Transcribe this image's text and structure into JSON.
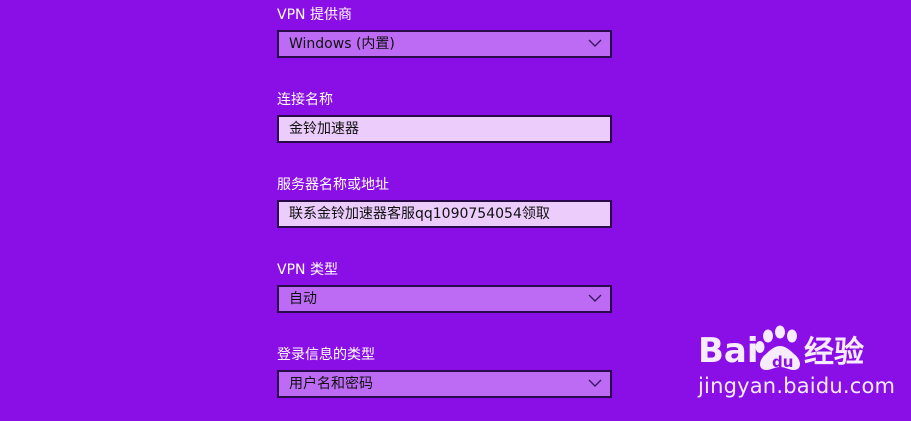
{
  "vpn_provider": {
    "label": "VPN 提供商",
    "value": "Windows (内置)"
  },
  "connection_name": {
    "label": "连接名称",
    "value": "金铃加速器"
  },
  "server_address": {
    "label": "服务器名称或地址",
    "value": "联系金铃加速器客服qq1090754054领取"
  },
  "vpn_type": {
    "label": "VPN 类型",
    "value": "自动"
  },
  "signin_info_type": {
    "label": "登录信息的类型",
    "value": "用户名和密码"
  },
  "watermark": {
    "logo_text": "Bai 经验",
    "url": "jingyan.baidu.com"
  },
  "colors": {
    "background": "#8a0ee6",
    "dropdown_fill": "#bd6bf5",
    "textbox_fill": "#ebccfb",
    "border": "#2a0a4a"
  }
}
